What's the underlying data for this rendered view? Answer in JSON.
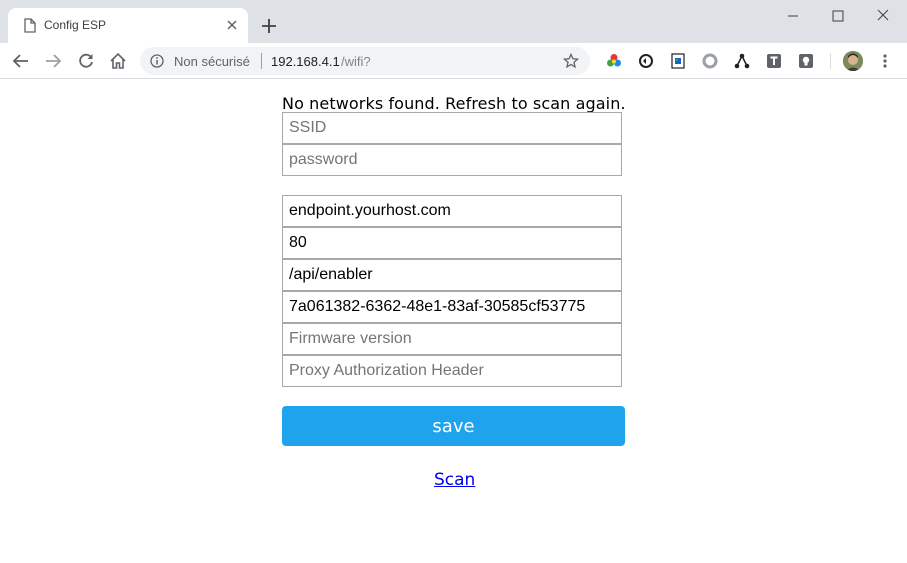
{
  "browser": {
    "tab_title": "Config ESP",
    "security_label": "Non sécurisé",
    "url_host": "192.168.4.1",
    "url_path": "/wifi?"
  },
  "page": {
    "message": "No networks found. Refresh to scan again.",
    "fields": [
      {
        "placeholder": "SSID",
        "value": ""
      },
      {
        "placeholder": "password",
        "value": ""
      },
      {
        "placeholder": "",
        "value": "endpoint.yourhost.com"
      },
      {
        "placeholder": "",
        "value": "80"
      },
      {
        "placeholder": "",
        "value": "/api/enabler"
      },
      {
        "placeholder": "",
        "value": "7a061382-6362-48e1-83af-30585cf53775"
      },
      {
        "placeholder": "Firmware version",
        "value": ""
      },
      {
        "placeholder": "Proxy Authorization Header",
        "value": ""
      }
    ],
    "save_label": "save",
    "scan_label": "Scan"
  },
  "colors": {
    "accent": "#1fa3ec",
    "link": "#0000ee"
  }
}
